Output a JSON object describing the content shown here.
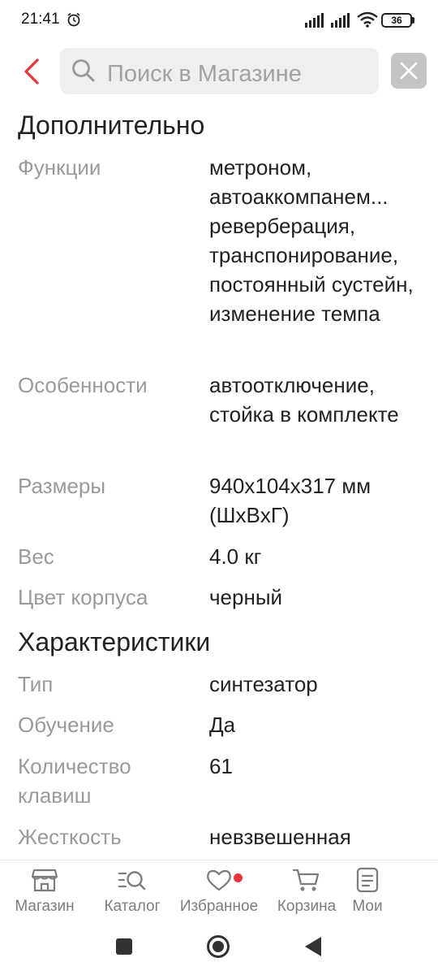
{
  "status": {
    "time": "21:41",
    "battery": "36"
  },
  "search": {
    "placeholder": "Поиск в Магазине"
  },
  "sections": [
    {
      "title": "Дополнительно",
      "rows": [
        {
          "label": "Функции",
          "value": "метроном, автоаккомпанем... реверберация, транспонирование, постоянный сустейн, изменение темпа"
        },
        {
          "label": "Особенности",
          "value": "автоотключение, стойка в комплекте"
        },
        {
          "label": "Размеры",
          "value": "940x104x317 мм (ШxВxГ)"
        },
        {
          "label": "Вес",
          "value": "4.0 кг"
        },
        {
          "label": "Цвет корпуса",
          "value": "черный"
        }
      ]
    },
    {
      "title": "Характеристики",
      "rows": [
        {
          "label": "Тип",
          "value": "синтезатор"
        },
        {
          "label": "Обучение",
          "value": "Да"
        },
        {
          "label": "Количество клавиш",
          "value": "61"
        },
        {
          "label": "Жесткость",
          "value": "невзвешенная"
        }
      ]
    }
  ],
  "bottom_nav": [
    {
      "label": "Магазин",
      "icon": "store-icon"
    },
    {
      "label": "Каталог",
      "icon": "catalog-search-icon"
    },
    {
      "label": "Избранное",
      "icon": "heart-icon"
    },
    {
      "label": "Корзина",
      "icon": "cart-icon"
    },
    {
      "label": "Мои",
      "icon": "orders-list-icon"
    }
  ],
  "colors": {
    "accent": "#e8353a",
    "label_gray": "#9a9a9a",
    "nav_gray": "#7d7d7d"
  }
}
